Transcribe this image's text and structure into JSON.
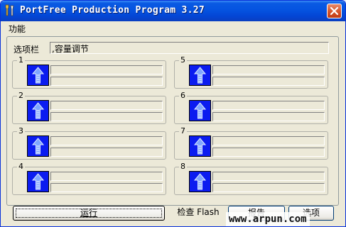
{
  "window": {
    "title": "PortFree Production Program 3.27"
  },
  "menu": {
    "items": [
      {
        "label": "功能"
      }
    ]
  },
  "options": {
    "label": "选项栏",
    "value": ",容量调节"
  },
  "ports": [
    {
      "number": "1"
    },
    {
      "number": "5"
    },
    {
      "number": "2"
    },
    {
      "number": "6"
    },
    {
      "number": "3"
    },
    {
      "number": "7"
    },
    {
      "number": "4"
    },
    {
      "number": "8"
    }
  ],
  "buttons": {
    "run": "运行",
    "check_flash": "检查 Flash",
    "report": "报告",
    "options": "选项"
  },
  "watermark": {
    "text": "www.arpun.com"
  },
  "icons": {
    "app": "tools-icon",
    "close": "close-icon",
    "port": "usb-upload-arrow-icon"
  },
  "colors": {
    "titlebar": "#0553e0",
    "port_icon_bg": "#0b1cf0",
    "window_bg": "#ece9d8"
  }
}
